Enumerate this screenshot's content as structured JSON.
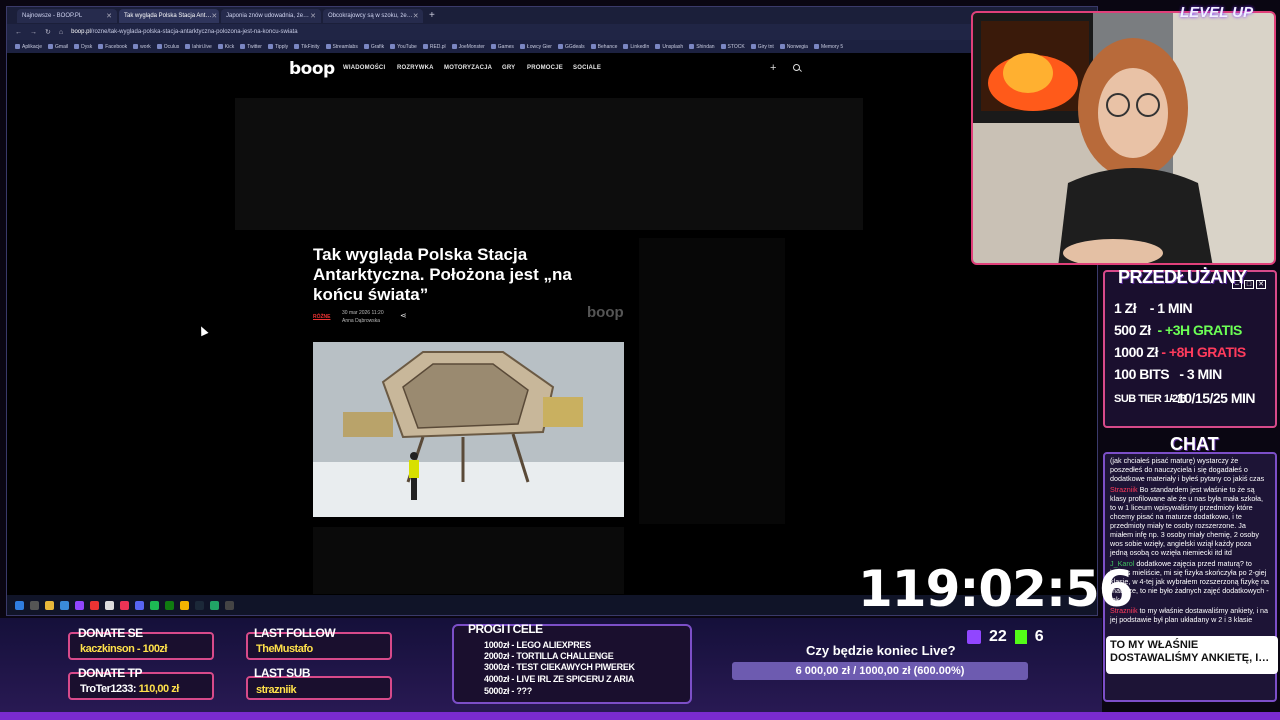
{
  "browser": {
    "tabs": [
      {
        "label": "Najnowsze - BOOP.PL",
        "active": false
      },
      {
        "label": "Tak wygląda Polska Stacja Ant…",
        "active": true
      },
      {
        "label": "Japonia znów udowadnia, że…",
        "active": false
      },
      {
        "label": "Obcokrajowcy są w szoku, że…",
        "active": false
      }
    ],
    "url_host": "boop.pl",
    "url_path": "/rozne/tak-wyglada-polska-stacja-antarktyczna-polozona-jest-na-koncu-swiata",
    "bookmarks": [
      "Aplikacje",
      "Gmail",
      "Dysk",
      "Facebook",
      "work",
      "Oculus",
      "lahiri.live",
      "Kick",
      "Twitter",
      "Tipply",
      "TikFinity",
      "Streamlabs",
      "Grafik",
      "YouTube",
      "RED.pl",
      "JoeMonster",
      "Games",
      "Łowcy Gier",
      "GGdeals",
      "Behance",
      "LinkedIn",
      "Unsplash",
      "Shindan",
      "STOCK",
      "Giry tnt",
      "Norwegia",
      "Memory 5"
    ]
  },
  "site": {
    "logo": "boop",
    "nav": [
      "WIADOMOŚCI",
      "ROZRYWKA",
      "MOTORYZACJA",
      "GRY",
      "PROMOCJE",
      "SOCIALE"
    ]
  },
  "article": {
    "headline": "Tak wygląda Polska Stacja Antarktyczna. Położona jest „na końcu świata”",
    "category": "RÓŻNE",
    "date": "30 mar 2026 11:20",
    "author": "Anna Dąbrowska",
    "watermark": "boop"
  },
  "overlay": {
    "brand": "LEVEL UP",
    "prices_title": "PRZEDŁUŻANY",
    "prices": [
      {
        "left": "1 Zł",
        "right": "- 1 MIN",
        "color": "white"
      },
      {
        "left": "500 Zł",
        "right": "- +3H GRATIS",
        "color": "green"
      },
      {
        "left": "1000 Zł",
        "right": "- +8H GRATIS",
        "color": "red"
      },
      {
        "left": "100 BITS",
        "right": "- 3 MIN",
        "color": "white"
      },
      {
        "left": "SUB TIER 1/2/3",
        "right": "- 10/15/25 MIN",
        "color": "white"
      }
    ],
    "chat_title": "CHAT",
    "chat": [
      {
        "user": "",
        "text": "(jak chciałeś pisać maturę) wystarczy że poszedłeś do nauczyciela i się dogadałeś o dodatkowe materiały i byłeś pytany co jakiś czas"
      },
      {
        "user": "Strazniik",
        "text": "Bo standardem jest właśnie to że są klasy profilowane ale że u nas była mała szkoła, to w 1 liceum wpisywaliśmy przedmioty które chcemy pisać na maturze dodatkowo, i te przedmioty miały te osoby rozszerzone. Ja miałem infę np. 3 osoby miały chemię, 2 osoby wos sobie wzięły, angielski wziął każdy poza jedną osobą co wzięła niemiecki itd itd"
      },
      {
        "user": "J_Karol",
        "text": "dodatkowe zajęcia przed maturą? to luksus mieliście, mi się fizyka skończyła po 2-giej klasie, w 4-tej jak wybrałem rozszerzoną fizykę na maturze, to nie było żadnych zajęć dodatkowych - tak"
      },
      {
        "user": "Strazniik",
        "text": "to my właśnie dostawaliśmy ankiety, i na jej podstawie był plan układany w 2 i 3 klasie"
      }
    ],
    "chat_banner": "TO MY WŁAŚNIE DOSTAWALIŚMY ANKIETĘ, I…",
    "timer": "119:02:56",
    "donate_se_label": "DONATE SE",
    "donate_se_value": "kaczkinson - 100zł",
    "donate_tp_label": "DONATE TP",
    "donate_tp_name": "TroTer1233:",
    "donate_tp_value": "110,00 zł",
    "last_follow_label": "LAST FOLLOW",
    "last_follow_value": "TheMustafo",
    "last_sub_label": "LAST SUB",
    "last_sub_value": "strazniik",
    "goals_title": "PROGI I CELE",
    "goals": [
      "1000zł - LEGO ALIEXPRES",
      "2000zł - TORTILLA CHALLENGE",
      "3000zł - TEST CIEKAWYCH PIWEREK",
      "4000zł - LIVE IRL ZE SPICERU Z ARIA",
      "5000zł - ???"
    ],
    "live_question": "Czy będzie koniec Live?",
    "progress_text": "6 000,00 zł / 1000,00 zł (600.00%)",
    "progress_fraction": 1.0,
    "twitch_viewers": "22",
    "kick_viewers": "6"
  }
}
